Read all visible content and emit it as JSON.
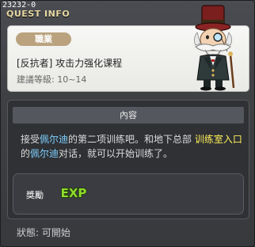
{
  "window": {
    "quest_id": "23232-0",
    "title": "QUEST INFO"
  },
  "header": {
    "job_badge": "職業",
    "quest_name": "[反抗者] 攻击力强化课程",
    "recommend_level": "建議等級: 10~14"
  },
  "content": {
    "header_label": "內容",
    "description_parts": [
      {
        "text": "接受",
        "type": "plain"
      },
      {
        "text": "佩尔迪",
        "type": "npc"
      },
      {
        "text": "的第二项训练吧。和地下总部 ",
        "type": "plain"
      },
      {
        "text": "训练室入口",
        "type": "place"
      },
      {
        "text": "的",
        "type": "plain"
      },
      {
        "text": "佩尔迪",
        "type": "npc"
      },
      {
        "text": "对话，就可以开始训练了。",
        "type": "plain"
      }
    ],
    "reward_label": "獎勵",
    "reward_icon": "exp-icon",
    "reward_icon_text": "EXP"
  },
  "status": {
    "text": "狀態:  可開始"
  },
  "colors": {
    "npc": "#7fd0ff",
    "place": "#ffef5a",
    "exp_fill": "#8fdc2c",
    "badge": "#b9a27d"
  }
}
